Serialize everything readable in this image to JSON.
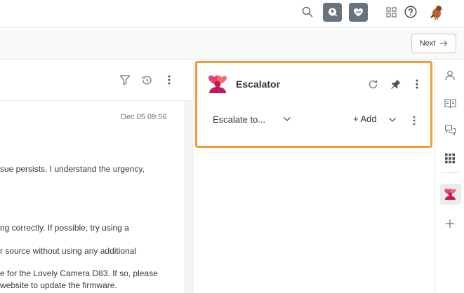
{
  "topbar": {
    "icons": [
      "search-icon",
      "app-icon",
      "app-icon",
      "grid-icon",
      "help-icon",
      "bird-avatar"
    ]
  },
  "subbar": {
    "next_label": "Next"
  },
  "conversation": {
    "timestamp": "Dec 05 09:56",
    "lines": [
      "sue persists. I understand the urgency,",
      "ng correctly. If possible, try using a",
      "r source without using any additional",
      "e for the Lovely Camera D83. If so, please",
      "website to update the firmware."
    ]
  },
  "escalator": {
    "title": "Escalator",
    "select_label": "Escalate to...",
    "add_label": "+ Add"
  },
  "colors": {
    "highlight": "#f79a3e",
    "app_button": "#68737d",
    "logo_pink": "#e83e75",
    "logo_dark": "#c2185b"
  }
}
